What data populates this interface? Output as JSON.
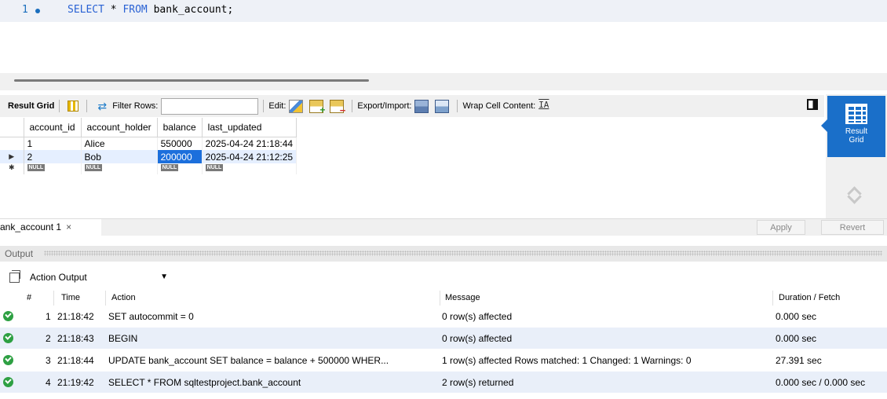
{
  "editor": {
    "line_number": "1",
    "code_keyword_select": "SELECT",
    "code_star": " * ",
    "code_keyword_from": "FROM",
    "code_rest": " bank_account;"
  },
  "result_toolbar": {
    "result_grid_label": "Result Grid",
    "filter_rows_label": "Filter Rows:",
    "filter_value": "",
    "edit_label": "Edit:",
    "export_import_label": "Export/Import:",
    "wrap_label": "Wrap Cell Content:"
  },
  "grid": {
    "columns": [
      "account_id",
      "account_holder",
      "balance",
      "last_updated"
    ],
    "rows": [
      [
        "1",
        "Alice",
        "550000",
        "2025-04-24 21:18:44"
      ],
      [
        "2",
        "Bob",
        "200000",
        "2025-04-24 21:12:25"
      ]
    ],
    "null_label": "NULL",
    "selected_row_marker": "▶",
    "new_row_marker": "✱"
  },
  "side_panel": {
    "result_grid_line1": "Result",
    "result_grid_line2": "Grid"
  },
  "tabs": {
    "active_tab": "ank_account 1",
    "close": "×",
    "apply": "Apply",
    "revert": "Revert"
  },
  "output": {
    "header": "Output",
    "selector": "Action Output",
    "columns": {
      "num": "#",
      "time": "Time",
      "action": "Action",
      "message": "Message",
      "duration": "Duration / Fetch"
    },
    "rows": [
      {
        "num": "1",
        "time": "21:18:42",
        "action": "SET autocommit = 0",
        "message": "0 row(s) affected",
        "duration": "0.000 sec"
      },
      {
        "num": "2",
        "time": "21:18:43",
        "action": "BEGIN",
        "message": "0 row(s) affected",
        "duration": "0.000 sec"
      },
      {
        "num": "3",
        "time": "21:18:44",
        "action": "UPDATE bank_account  SET balance = balance + 500000  WHER...",
        "message": "1 row(s) affected Rows matched: 1  Changed: 1  Warnings: 0",
        "duration": "27.391 sec"
      },
      {
        "num": "4",
        "time": "21:19:42",
        "action": "SELECT * FROM sqltestproject.bank_account",
        "message": "2 row(s) returned",
        "duration": "0.000 sec / 0.000 sec"
      }
    ]
  }
}
